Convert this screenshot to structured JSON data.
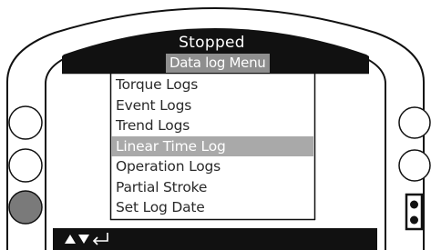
{
  "status": {
    "title": "Stopped"
  },
  "menu": {
    "title": "Data log Menu",
    "items": [
      {
        "label": "Torque Logs",
        "selected": false
      },
      {
        "label": "Event Logs",
        "selected": false
      },
      {
        "label": "Trend Logs",
        "selected": false
      },
      {
        "label": "Linear Time Log",
        "selected": true
      },
      {
        "label": "Operation Logs",
        "selected": false
      },
      {
        "label": "Partial Stroke",
        "selected": false
      },
      {
        "label": "Set Log Date",
        "selected": false
      }
    ]
  },
  "icons": {
    "nav": [
      "up-arrow-icon",
      "down-arrow-icon",
      "enter-icon"
    ],
    "side": "two-dot-indicator-icon"
  },
  "colors": {
    "display_bar": "#111111",
    "selected_row": "#a9a9a9",
    "menu_title_bg": "#8e8e8e",
    "text": "#2a2a2a",
    "filled_led": "#7a7a7a"
  }
}
